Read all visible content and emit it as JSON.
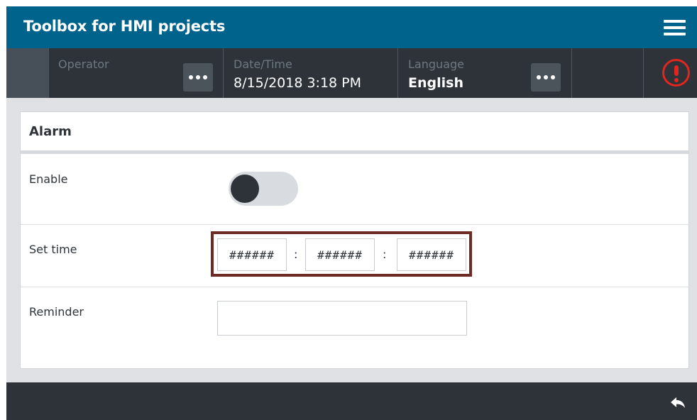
{
  "header": {
    "title": "Toolbox for HMI projects",
    "menu_icon": "hamburger-menu-icon"
  },
  "status": {
    "operator_label": "Operator",
    "operator_value": "",
    "datetime_label": "Date/Time",
    "datetime_value": "8/15/2018 3:18 PM",
    "language_label": "Language",
    "language_value": "English",
    "more_icon": "ellipsis-icon",
    "alarm_icon": "exclamation-circle-icon",
    "alarm_color": "#e0261f"
  },
  "panel": {
    "title": "Alarm",
    "enable": {
      "label": "Enable",
      "state": "off"
    },
    "set_time": {
      "label": "Set time",
      "hours": "######",
      "minutes": "######",
      "seconds": "######",
      "separator": ":"
    },
    "reminder": {
      "label": "Reminder",
      "value": ""
    }
  },
  "footer": {
    "back_icon": "back-arrow-icon"
  },
  "colors": {
    "title_bar": "#00638c",
    "status_bar": "#2d3339",
    "highlight_border": "#6e2a25"
  }
}
